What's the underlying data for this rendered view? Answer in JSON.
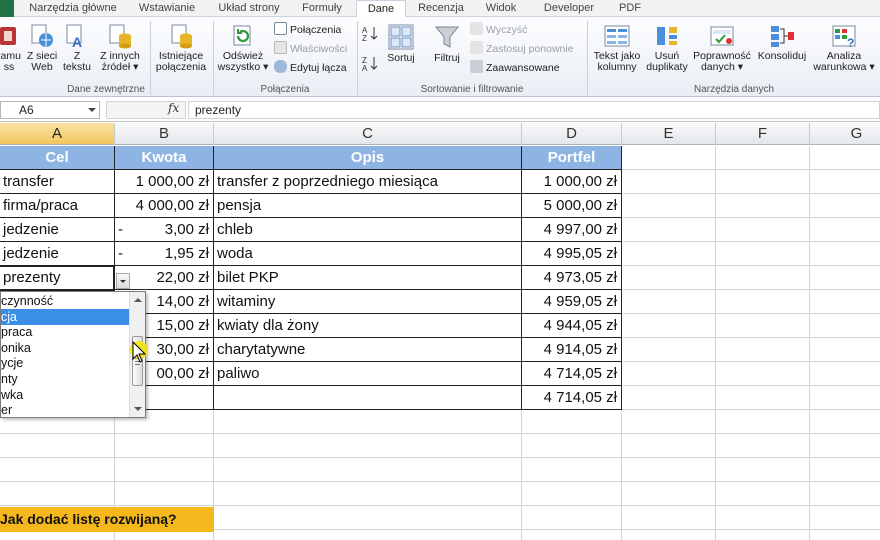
{
  "tabs": [
    "Narzędzia główne",
    "Wstawianie",
    "Układ strony",
    "Formuły",
    "Dane",
    "Recenzja",
    "Widok",
    "Developer",
    "PDF"
  ],
  "active_tab": "Dane",
  "ribbon": {
    "ext": {
      "b1": "ramu\nss",
      "b2": "Z sieci\nWeb",
      "b3": "Z\ntekstu",
      "b4": "Z innych\nźródeł ▾",
      "b5": "Istniejące\npołączenia",
      "label": "Dane zewnętrzne"
    },
    "conn": {
      "refresh": "Odśwież\nwszystko ▾",
      "connections": "Połączenia",
      "properties": "Właściwości",
      "edit_links": "Edytuj łącza",
      "label": "Połączenia"
    },
    "sort": {
      "sort": "Sortuj",
      "filter": "Filtruj",
      "clear": "Wyczyść",
      "reapply": "Zastosuj ponownie",
      "advanced": "Zaawansowane",
      "label": "Sortowanie i filtrowanie"
    },
    "tools": {
      "text_to_cols": "Tekst jako\nkolumny",
      "remove_dup": "Usuń\nduplikaty",
      "validation": "Poprawność\ndanych ▾",
      "consolidate": "Konsoliduj",
      "whatif": "Analiza\nwarunkowa ▾",
      "label": "Narzędzia danych"
    }
  },
  "formula_bar": {
    "name_box": "A6",
    "fx": "fx",
    "value": "prezenty"
  },
  "columns": [
    "A",
    "B",
    "C",
    "D",
    "E",
    "F",
    "G"
  ],
  "headers": [
    "Cel",
    "Kwota",
    "Opis",
    "Portfel"
  ],
  "rows": [
    {
      "a": "transfer",
      "minus": "",
      "b": "1 000,00 zł",
      "c": "transfer z poprzedniego miesiąca",
      "d": "1 000,00 zł"
    },
    {
      "a": "firma/praca",
      "minus": "",
      "b": "4 000,00 zł",
      "c": "pensja",
      "d": "5 000,00 zł"
    },
    {
      "a": "jedzenie",
      "minus": "-",
      "b": "3,00 zł",
      "c": "chleb",
      "d": "4 997,00 zł"
    },
    {
      "a": "jedzenie",
      "minus": "-",
      "b": "1,95 zł",
      "c": "woda",
      "d": "4 995,05 zł"
    },
    {
      "a": "prezenty",
      "minus": "",
      "b": "22,00 zł",
      "c": "bilet PKP",
      "d": "4 973,05 zł"
    },
    {
      "a": "",
      "minus": "",
      "b": "14,00 zł",
      "c": "witaminy",
      "d": "4 959,05 zł"
    },
    {
      "a": "",
      "minus": "",
      "b": "15,00 zł",
      "c": "kwiaty dla żony",
      "d": "4 944,05 zł"
    },
    {
      "a": "",
      "minus": "",
      "b": "30,00 zł",
      "c": "charytatywne",
      "d": "4 914,05 zł"
    },
    {
      "a": "",
      "minus": "",
      "b": "00,00 zł",
      "c": "paliwo",
      "d": "4 714,05 zł"
    },
    {
      "a": "",
      "minus": "",
      "b": "",
      "c": "",
      "d": "4 714,05 zł"
    }
  ],
  "dropdown": {
    "items": [
      "czynność",
      "cja",
      "praca",
      "onika",
      "ycje",
      "nty",
      "wka",
      "er"
    ],
    "highlighted": 1
  },
  "caption": "Jak dodać listę rozwijaną?"
}
